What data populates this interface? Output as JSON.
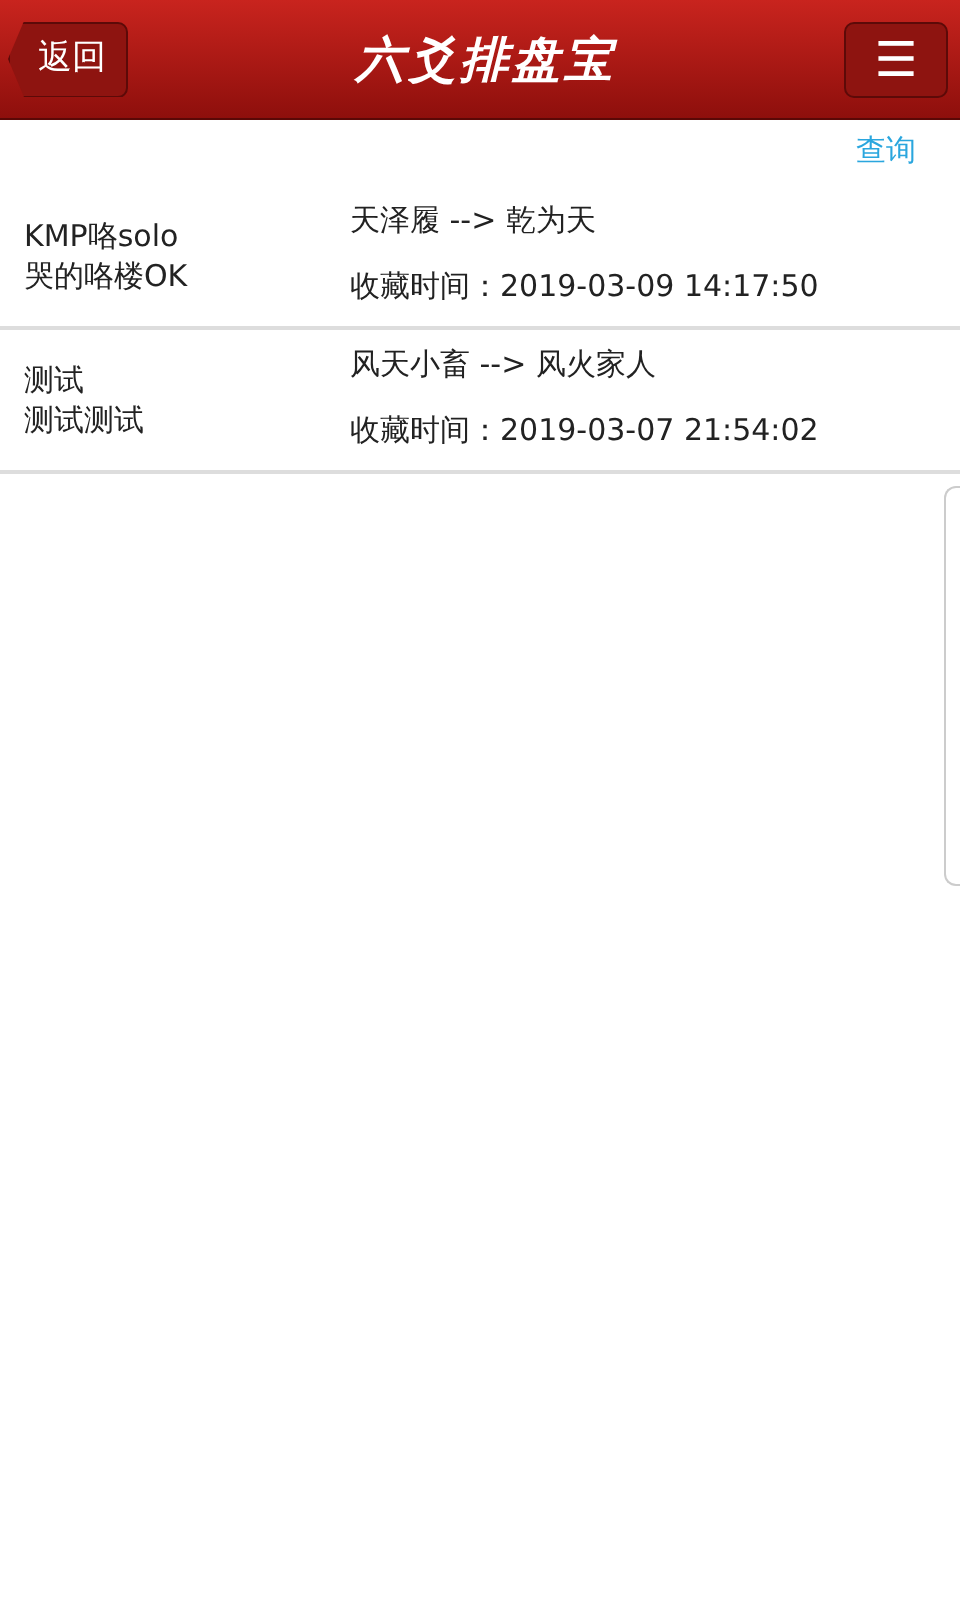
{
  "header": {
    "back": "返回",
    "title": "六爻排盘宝",
    "menu": "☰"
  },
  "query_link": "查询",
  "records": [
    {
      "name_lines": [
        "KMP咯solo",
        "哭的咯楼OK"
      ],
      "change": "天泽履 --> 乾为天",
      "saved_time": "收藏时间：2019-03-09 14:17:50"
    },
    {
      "name_lines": [
        "测试",
        "测试测试"
      ],
      "change": "风天小畜 --> 风火家人",
      "saved_time": "收藏时间：2019-03-07 21:54:02"
    }
  ]
}
